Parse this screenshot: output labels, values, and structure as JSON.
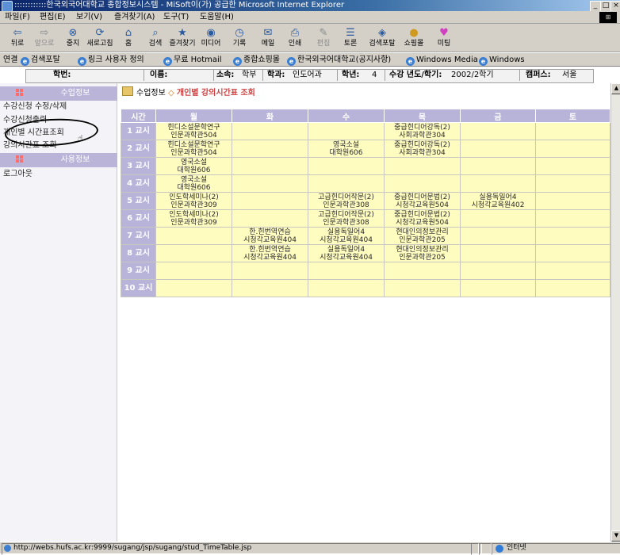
{
  "window": {
    "title": "::::::::::::한국외국어대학교 종합정보시스템 - MiSoft이(가) 공급한 Microsoft Internet Explorer"
  },
  "menu": [
    "파일(F)",
    "편집(E)",
    "보기(V)",
    "즐겨찾기(A)",
    "도구(T)",
    "도움말(H)"
  ],
  "toolbar": [
    {
      "label": "뒤로",
      "icon": "back-arrow-icon"
    },
    {
      "label": "앞으로",
      "icon": "forward-arrow-icon"
    },
    {
      "label": "중지",
      "icon": "stop-icon"
    },
    {
      "label": "새로고침",
      "icon": "refresh-icon"
    },
    {
      "label": "홈",
      "icon": "home-icon"
    },
    {
      "label": "검색",
      "icon": "search-icon"
    },
    {
      "label": "즐겨찾기",
      "icon": "favorites-icon"
    },
    {
      "label": "미디어",
      "icon": "media-icon"
    },
    {
      "label": "기록",
      "icon": "history-icon"
    },
    {
      "label": "메일",
      "icon": "mail-icon"
    },
    {
      "label": "인쇄",
      "icon": "print-icon"
    },
    {
      "label": "편집",
      "icon": "edit-icon"
    },
    {
      "label": "토론",
      "icon": "discuss-icon"
    },
    {
      "label": "검색포탈",
      "icon": "search-portal-icon"
    },
    {
      "label": "쇼핑몰",
      "icon": "shopping-icon"
    },
    {
      "label": "미팅",
      "icon": "meeting-icon"
    }
  ],
  "links": {
    "label": "연결",
    "items": [
      "검색포탈",
      "링크 사용자 정의",
      "무료 Hotmail",
      "종합쇼핑몰",
      "한국외국어대학교(공지사항)",
      "Windows Media",
      "Windows"
    ]
  },
  "info": {
    "student_id_label": "학번:",
    "name_label": "이름:",
    "affiliation_label": "소속:",
    "affiliation": "학부",
    "dept_label": "학과:",
    "dept": "인도어과",
    "grade_label": "학년:",
    "grade": "4",
    "term_label": "수강 년도/학기:",
    "term": "2002/2학기",
    "campus_label": "캠퍼스:",
    "campus": "서울"
  },
  "nav": {
    "section1": "수업정보",
    "items": [
      "수강신청 수정/삭제",
      "수강신청출력",
      "개인별 시간표조회",
      "강의시간표 조회"
    ],
    "section2": "사용정보",
    "logout": "로그아웃"
  },
  "breadcrumb": {
    "parent": "수업정보",
    "separator": "◇",
    "current": "개인별 강의시간표 조회"
  },
  "timetable": {
    "header": [
      "시간",
      "월",
      "화",
      "수",
      "목",
      "금",
      "토"
    ],
    "rows": [
      {
        "period": "1 교시",
        "cells": [
          "힌디소설문학연구\n인문과학관504",
          "",
          "",
          "중급힌디어강독(2)\n사회과학관304",
          "",
          ""
        ]
      },
      {
        "period": "2 교시",
        "cells": [
          "힌디소설문학연구\n인문과학관504",
          "",
          "영국소설\n대학원606",
          "중급힌디어강독(2)\n사회과학관304",
          "",
          ""
        ]
      },
      {
        "period": "3 교시",
        "cells": [
          "영국소설\n대학원606",
          "",
          "",
          "",
          "",
          ""
        ]
      },
      {
        "period": "4 교시",
        "cells": [
          "영국소설\n대학원606",
          "",
          "",
          "",
          "",
          ""
        ]
      },
      {
        "period": "5 교시",
        "cells": [
          "인도학세미나(2)\n인문과학관309",
          "",
          "고급힌디어작문(2)\n인문과학관308",
          "중급힌디어문법(2)\n시청각교육원504",
          "실용독일어4\n시청각교육원402",
          ""
        ]
      },
      {
        "period": "6 교시",
        "cells": [
          "인도학세미나(2)\n인문과학관309",
          "",
          "고급힌디어작문(2)\n인문과학관308",
          "중급힌디어문법(2)\n시청각교육원504",
          "",
          ""
        ]
      },
      {
        "period": "7 교시",
        "cells": [
          "",
          "한.힌번역연습\n시청각교육원404",
          "실용독일어4\n시청각교육원404",
          "현대인의정보관리\n인문과학관205",
          "",
          ""
        ]
      },
      {
        "period": "8 교시",
        "cells": [
          "",
          "한.힌번역연습\n시청각교육원404",
          "실용독일어4\n시청각교육원404",
          "현대인의정보관리\n인문과학관205",
          "",
          ""
        ]
      },
      {
        "period": "9 교시",
        "cells": [
          "",
          "",
          "",
          "",
          "",
          ""
        ]
      },
      {
        "period": "10 교시",
        "cells": [
          "",
          "",
          "",
          "",
          "",
          ""
        ]
      }
    ]
  },
  "status": {
    "url": "http://webs.hufs.ac.kr:9999/sugang/jsp/sugang/stud_TimeTable.jsp",
    "zone": "인터넷"
  }
}
